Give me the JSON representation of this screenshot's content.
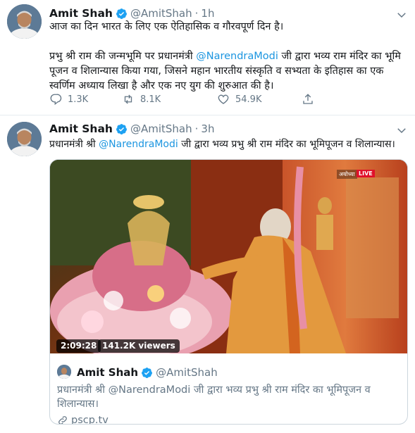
{
  "colors": {
    "link": "#1b95e0",
    "secondary": "#657786",
    "verified": "#1da1f2",
    "live": "#e0102a"
  },
  "tweets": [
    {
      "author": {
        "name": "Amit Shah",
        "handle": "@AmitShah",
        "verified": true
      },
      "separator": "·",
      "time": "1h",
      "line1": "आज का दिन भारत के लिए एक ऐतिहासिक व गौरवपूर्ण दिन है।",
      "line2_prefix": "प्रभु श्री राम की जन्मभूमि पर प्रधानमंत्री ",
      "line2_mention": "@NarendraModi",
      "line2_suffix": " जी द्वारा भव्य राम मंदिर का भूमि पूजन व शिलान्यास किया गया, जिसने महान भारतीय संस्कृति व सभ्यता के इतिहास का एक स्वर्णिम अध्याय लिखा है और एक नए युग की शुरुआत की है।",
      "actions": {
        "reply_icon": "reply-icon",
        "replies": "1.3K",
        "retweet_icon": "retweet-icon",
        "retweets": "8.1K",
        "like_icon": "like-icon",
        "likes": "54.9K"
      }
    },
    {
      "author": {
        "name": "Amit Shah",
        "handle": "@AmitShah",
        "verified": true
      },
      "separator": "·",
      "time": "3h",
      "text_prefix": "प्रधानमंत्री श्री ",
      "text_mention": "@NarendraModi",
      "text_suffix": " जी द्वारा भव्य प्रभु श्री राम मंदिर का भूमिपूजन व शिलान्यास।",
      "video": {
        "duration": "2:09:28",
        "viewers": "141.2K viewers",
        "channel": "अयोध्या",
        "live": "LIVE"
      },
      "quote": {
        "author": {
          "name": "Amit Shah",
          "handle": "@AmitShah",
          "verified": true
        },
        "text": "प्रधानमंत्री श्री @NarendraModi जी द्वारा भव्य प्रभु श्री राम मंदिर का भूमिपूजन व शिलान्यास।",
        "link_icon": "link-icon",
        "link": "pscp.tv"
      }
    }
  ]
}
